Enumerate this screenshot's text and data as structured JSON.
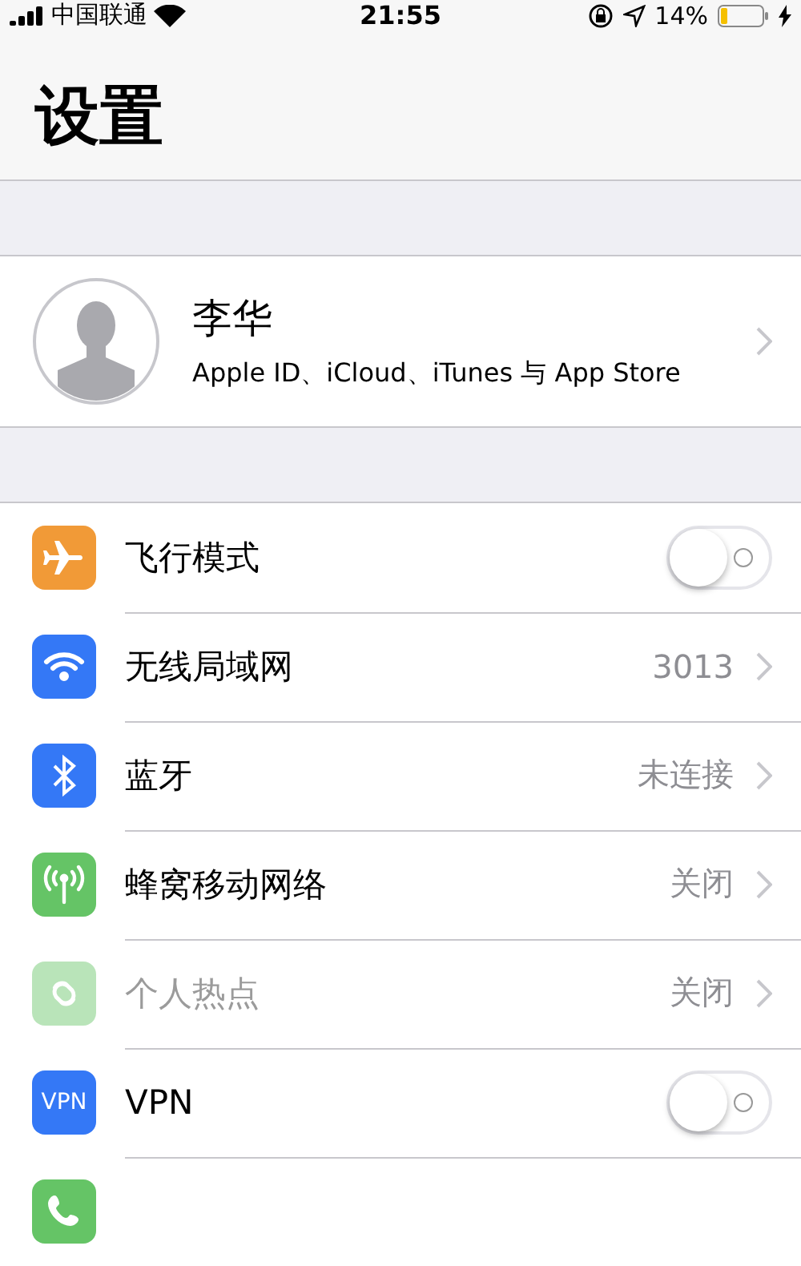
{
  "status_bar": {
    "carrier": "中国联通",
    "time": "21:55",
    "battery": "14%"
  },
  "title": "设置",
  "profile": {
    "name": "李华",
    "subtitle": "Apple ID、iCloud、iTunes 与 App Store"
  },
  "rows": [
    {
      "kind": "toggle",
      "label": "飞行模式",
      "on": false,
      "disabled": false
    },
    {
      "kind": "link",
      "label": "无线局域网",
      "value": "3013",
      "disabled": false
    },
    {
      "kind": "link",
      "label": "蓝牙",
      "value": "未连接",
      "disabled": false
    },
    {
      "kind": "link",
      "label": "蜂窝移动网络",
      "value": "关闭",
      "disabled": false
    },
    {
      "kind": "link",
      "label": "个人热点",
      "value": "关闭",
      "disabled": true
    },
    {
      "kind": "toggle",
      "label": "VPN",
      "icon_text": "VPN",
      "on": false,
      "disabled": false
    },
    {
      "kind": "partial"
    }
  ]
}
